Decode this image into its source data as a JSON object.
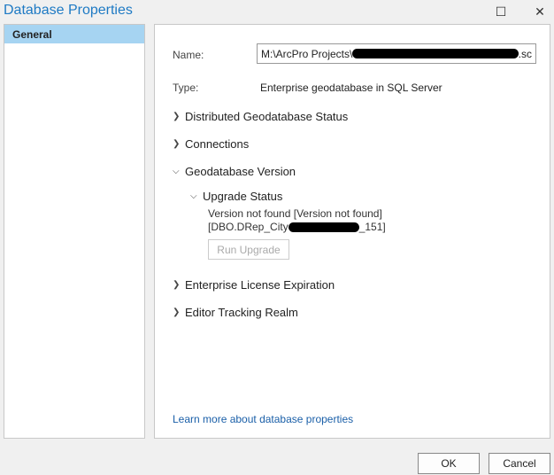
{
  "window": {
    "title": "Database Properties"
  },
  "sidebar": {
    "items": [
      {
        "label": "General"
      }
    ]
  },
  "general": {
    "name_label": "Name:",
    "name_value_prefix": "M:\\ArcPro Projects\\",
    "name_value_suffix": ".sc",
    "type_label": "Type:",
    "type_value": "Enterprise geodatabase in SQL Server",
    "sections": [
      {
        "label": "Distributed Geodatabase Status"
      },
      {
        "label": "Connections"
      },
      {
        "label": "Geodatabase Version"
      },
      {
        "label": "Enterprise License Expiration"
      },
      {
        "label": "Editor Tracking Realm"
      }
    ],
    "upgrade": {
      "label": "Upgrade Status",
      "status": "Version not found [Version not found]",
      "version_prefix": "[DBO.DRep_City",
      "version_suffix": "_151]",
      "button": "Run Upgrade"
    },
    "learn_more": "Learn more about database properties"
  },
  "footer": {
    "ok": "OK",
    "cancel": "Cancel"
  }
}
